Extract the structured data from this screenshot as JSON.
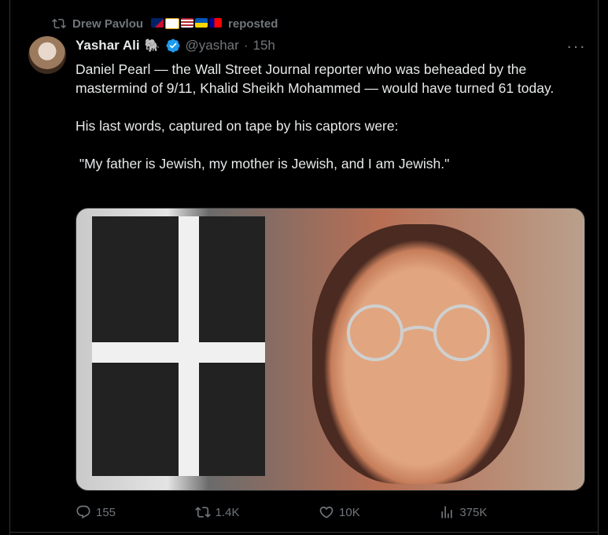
{
  "repost": {
    "label": "Drew Pavlou",
    "suffix": "reposted"
  },
  "tweet": {
    "author_name": "Yashar Ali",
    "handle": "@yashar",
    "time": "15h",
    "text_1": "Daniel Pearl — the Wall Street Journal reporter who was beheaded by the mastermind of 9/11, Khalid Sheikh Mohammed — would have turned 61 today.",
    "text_2": "His last words, captured on tape by his captors were:",
    "text_3": " \"My father is Jewish, my mother is Jewish, and I am Jewish.\""
  },
  "actions": {
    "replies": "155",
    "reposts": "1.4K",
    "likes": "10K",
    "views": "375K"
  },
  "colors": {
    "background": "#000000",
    "text": "#e7e9ea",
    "muted": "#71767b",
    "verified": "#1d9bf0"
  }
}
